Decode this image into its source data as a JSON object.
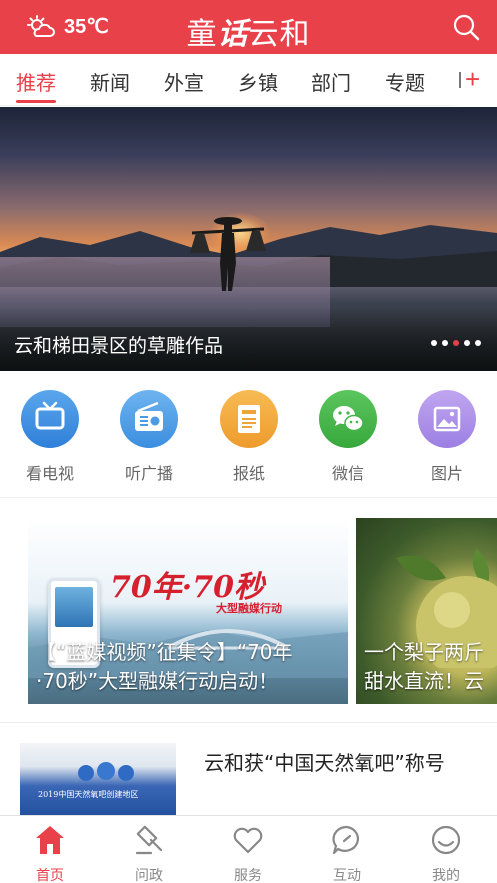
{
  "header": {
    "temperature": "35℃",
    "weather_icon": "partly-cloudy-sun-icon",
    "logo_part1": "童",
    "logo_part2": "话",
    "logo_part3": "云和",
    "search_icon": "search-icon"
  },
  "tabs": [
    {
      "label": "推荐",
      "active": true
    },
    {
      "label": "新闻"
    },
    {
      "label": "外宣"
    },
    {
      "label": "乡镇"
    },
    {
      "label": "部门"
    },
    {
      "label": "专题"
    }
  ],
  "banner": {
    "caption": "云和梯田景区的草雕作品",
    "dot_count": 5,
    "active_dot": 2
  },
  "quick_links": [
    {
      "label": "看电视",
      "icon": "tv-icon",
      "color": "#3e8fe0"
    },
    {
      "label": "听广播",
      "icon": "radio-icon",
      "color": "#4aa0e6"
    },
    {
      "label": "报纸",
      "icon": "newspaper-icon",
      "color": "#f0a33a"
    },
    {
      "label": "微信",
      "icon": "wechat-icon",
      "color": "#43b44a"
    },
    {
      "label": "图片",
      "icon": "image-icon",
      "color": "#a98be6"
    }
  ],
  "feature_cards": [
    {
      "line1": "【“蓝媒视频”征集令】“70年",
      "line2": "·70秒”大型融媒行动启动！",
      "poster_main": "70年·70秒",
      "poster_sub": "大型融媒行动"
    },
    {
      "line1": "一个梨子两斤",
      "line2": "甜水直流！云"
    }
  ],
  "news": {
    "title": "云和获“中国天然氧吧”称号",
    "thumb_banner": "2019中国天然氧吧创建地区"
  },
  "bottom_nav": [
    {
      "label": "首页",
      "icon": "home-icon",
      "active": true
    },
    {
      "label": "问政",
      "icon": "gavel-icon"
    },
    {
      "label": "服务",
      "icon": "heart-icon"
    },
    {
      "label": "互动",
      "icon": "chat-bubble-icon"
    },
    {
      "label": "我的",
      "icon": "smiley-face-icon"
    }
  ],
  "colors": {
    "brand_red": "#e8414a",
    "inactive_gray": "#888888"
  }
}
